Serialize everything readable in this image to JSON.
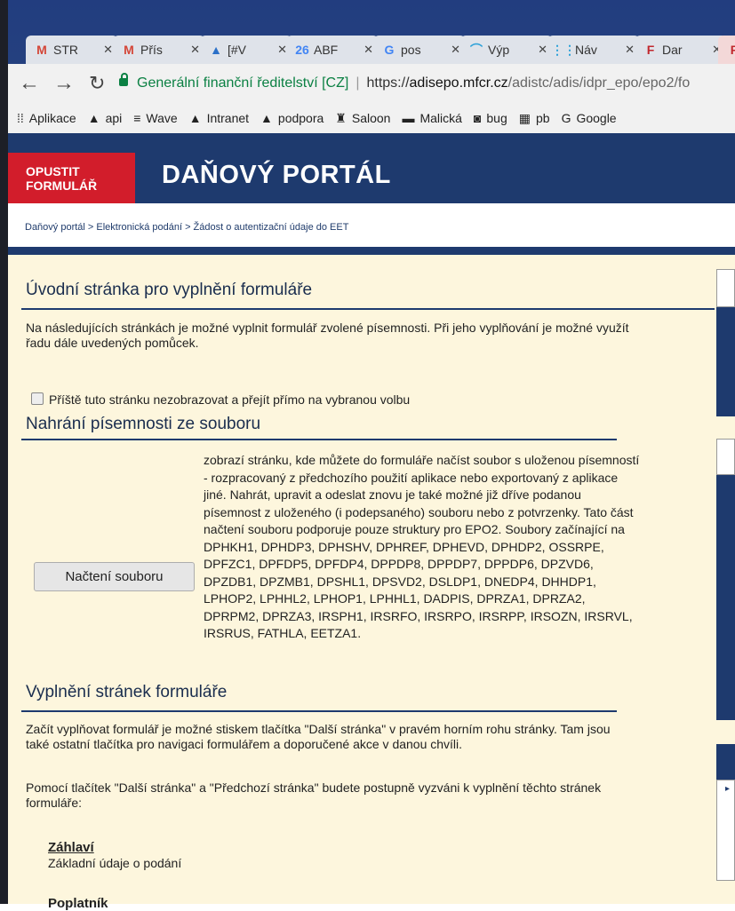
{
  "browser": {
    "tabs": [
      {
        "icon": "gmail-icon",
        "glyph": "M",
        "color": "#d44638",
        "label": "STR"
      },
      {
        "icon": "gmail-icon",
        "glyph": "M",
        "color": "#d44638",
        "label": "Přís"
      },
      {
        "icon": "atlassian-icon",
        "glyph": "▲",
        "color": "#2b70c8",
        "label": "[#V"
      },
      {
        "icon": "calendar-icon",
        "glyph": "26",
        "color": "#4285f4",
        "label": "ABF"
      },
      {
        "icon": "google-icon",
        "glyph": "G",
        "color": "#4285f4",
        "label": "pos"
      },
      {
        "icon": "feed-icon",
        "glyph": "⌒",
        "color": "#2aa0d8",
        "label": "Výp"
      },
      {
        "icon": "apps-icon",
        "glyph": "⋮⋮",
        "color": "#2aa0d8",
        "label": "Náv"
      },
      {
        "icon": "f-icon",
        "glyph": "F",
        "color": "#c1272d",
        "label": "Dar"
      },
      {
        "icon": "f-icon",
        "glyph": "F",
        "color": "#c1272d",
        "label": ""
      }
    ],
    "url": {
      "site_name": "Generální finanční ředitelství [CZ]",
      "scheme": "https://",
      "host": "adisepo.mfcr.cz",
      "path": "/adistc/adis/idpr_epo/epo2/fo"
    },
    "bookmarks": [
      {
        "icon": "apps-grid-icon",
        "glyph": "⁞⁞",
        "label": "Aplikace"
      },
      {
        "icon": "api-icon",
        "glyph": "▲",
        "label": "api"
      },
      {
        "icon": "wave-icon",
        "glyph": "≡",
        "label": "Wave"
      },
      {
        "icon": "intranet-icon",
        "glyph": "▲",
        "label": "Intranet"
      },
      {
        "icon": "podpora-icon",
        "glyph": "▲",
        "label": "podpora"
      },
      {
        "icon": "saloon-icon",
        "glyph": "♜",
        "label": "Saloon"
      },
      {
        "icon": "malicka-icon",
        "glyph": "▬",
        "label": "Malická"
      },
      {
        "icon": "bug-icon",
        "glyph": "◙",
        "label": "bug"
      },
      {
        "icon": "pb-icon",
        "glyph": "▦",
        "label": "pb"
      },
      {
        "icon": "google-icon",
        "glyph": "G",
        "label": "Google"
      }
    ]
  },
  "portal": {
    "exit_label_1": "OPUSTIT",
    "exit_label_2": "FORMULÁŘ",
    "title": "DAŇOVÝ PORTÁL",
    "breadcrumb": "Daňový portál > Elektronická podání > Žádost o autentizační údaje do EET"
  },
  "main": {
    "intro_title": "Úvodní stránka pro vyplnění formuláře",
    "intro_text_1": "Na následujících stránkách je možné vyplnit formulář zvolené písemnosti. Při jeho vyplňování je možné využít",
    "intro_text_2": "řadu dále uvedených pomůcek.",
    "checkbox_label": "Příště tuto stránku nezobrazovat a přejít přímo na vybranou volbu",
    "upload_title": "Nahrání písemnosti ze souboru",
    "load_button": "Načtení souboru",
    "upload_text": [
      "zobrazí stránku, kde můžete do formuláře načíst soubor s uloženou písemností",
      "- rozpracovaný z předchozího použití aplikace nebo exportovaný z aplikace",
      "jiné. Nahrát, upravit a odeslat znovu je také možné již dříve podanou",
      "písemnost z uloženého (i podepsaného) souboru nebo z potvrzenky. Tato část",
      "načtení souboru podporuje pouze struktury pro EPO2. Soubory začínající na",
      "DPHKH1, DPHDP3, DPHSHV, DPHREF, DPHEVD, DPHDP2, OSSRPE,",
      "DPFZC1, DPFDP5, DPFDP4, DPPDP8, DPPDP7, DPPDP6, DPZVD6,",
      "DPZDB1, DPZMB1, DPSHL1, DPSVD2, DSLDP1, DNEDP4, DHHDP1,",
      "LPHOP2, LPHHL2, LPHOP1, LPHHL1, DADPIS, DPRZA1, DPRZA2,",
      "DPRPM2, DPRZA3, IRSPH1, IRSRFO, IRSRPO, IRSRPP, IRSOZN, IRSRVL,",
      "IRSRUS, FATHLA, EETZA1."
    ],
    "fill_title": "Vyplnění stránek formuláře",
    "fill_text_1": "Začít vyplňovat formulář je možné stiskem tlačítka \"Další stránka\" v pravém horním rohu stránky. Tam jsou",
    "fill_text_2": "také ostatní tlačítka pro navigaci formulářem a doporučené akce v danou chvíli.",
    "fill_text_3": "Pomocí tlačítek \"Další stránka\" a \"Předchozí stránka\" budete postupně vyzváni k vyplnění těchto stránek",
    "fill_text_4": "formuláře:",
    "section_link": "Záhlaví",
    "section_desc": "Základní údaje o podání",
    "next_link_partial": "Poplatník"
  }
}
